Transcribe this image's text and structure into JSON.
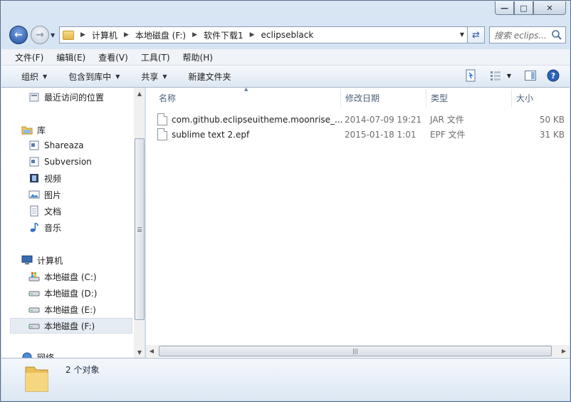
{
  "titlebar": {
    "minimize_label": "—",
    "maximize_label": "□",
    "close_label": "✕"
  },
  "address": {
    "crumbs": [
      "计算机",
      "本地磁盘 (F:)",
      "软件下载1",
      "eclipseblack"
    ]
  },
  "search": {
    "placeholder": "搜索 eclips..."
  },
  "menu": [
    "文件(F)",
    "编辑(E)",
    "查看(V)",
    "工具(T)",
    "帮助(H)"
  ],
  "commands": {
    "organize": "组织",
    "include_library": "包含到库中",
    "share": "共享",
    "new_folder": "新建文件夹"
  },
  "sidebar": {
    "recent": "最近访问的位置",
    "libraries": "库",
    "lib_items": [
      "Shareaza",
      "Subversion",
      "视频",
      "图片",
      "文档",
      "音乐"
    ],
    "computer": "计算机",
    "drives": [
      "本地磁盘 (C:)",
      "本地磁盘 (D:)",
      "本地磁盘 (E:)",
      "本地磁盘 (F:)"
    ],
    "network": "网络",
    "selected_drive": "本地磁盘 (F:)"
  },
  "columns": {
    "name": "名称",
    "date": "修改日期",
    "type": "类型",
    "size": "大小"
  },
  "files": [
    {
      "name": "com.github.eclipseuitheme.moonrise_...",
      "date": "2014-07-09 19:21",
      "type": "JAR 文件",
      "size": "50 KB"
    },
    {
      "name": "sublime text 2.epf",
      "date": "2015-01-18 1:01",
      "type": "EPF 文件",
      "size": "31 KB"
    }
  ],
  "status": {
    "count_text": "2 个对象"
  },
  "colors": {
    "accent": "#1d4e9e",
    "window_frame": "#c3d4e8",
    "folder": "#e4b64b"
  }
}
